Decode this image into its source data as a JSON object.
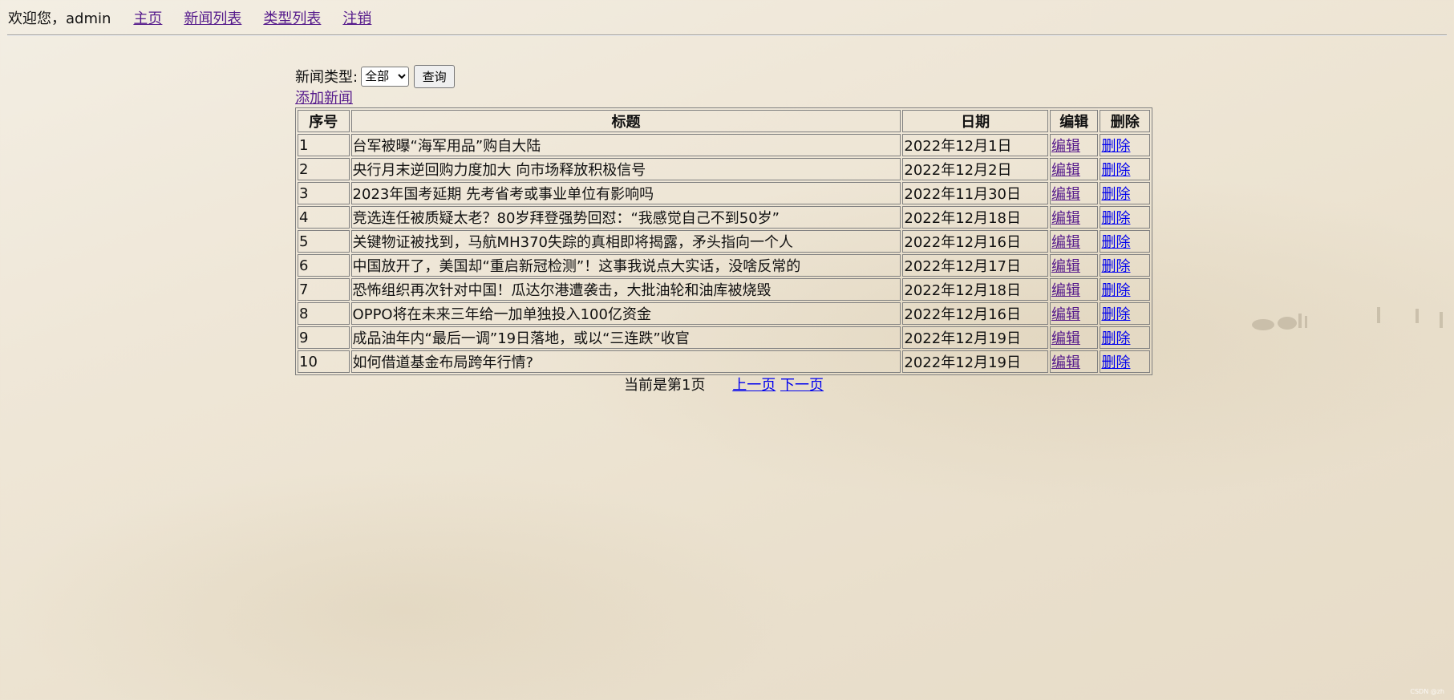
{
  "nav": {
    "welcome": "欢迎您，admin",
    "links": [
      "主页",
      "新闻列表",
      "类型列表",
      "注销"
    ]
  },
  "filter": {
    "label": "新闻类型:",
    "selected": "全部",
    "button": "查询"
  },
  "add_link": "添加新闻",
  "table": {
    "headers": [
      "序号",
      "标题",
      "日期",
      "编辑",
      "删除"
    ],
    "rows": [
      {
        "id": "1",
        "title": "台军被曝“海军用品”购自大陆",
        "date": "2022年12月1日",
        "edit": "编辑",
        "delete": "删除"
      },
      {
        "id": "2",
        "title": "央行月末逆回购力度加大 向市场释放积极信号",
        "date": "2022年12月2日",
        "edit": "编辑",
        "delete": "删除"
      },
      {
        "id": "3",
        "title": "2023年国考延期 先考省考或事业单位有影响吗",
        "date": "2022年11月30日",
        "edit": "编辑",
        "delete": "删除"
      },
      {
        "id": "4",
        "title": "竞选连任被质疑太老？80岁拜登强势回怼：“我感觉自己不到50岁”",
        "date": "2022年12月18日",
        "edit": "编辑",
        "delete": "删除"
      },
      {
        "id": "5",
        "title": "关键物证被找到，马航MH370失踪的真相即将揭露，矛头指向一个人",
        "date": "2022年12月16日",
        "edit": "编辑",
        "delete": "删除"
      },
      {
        "id": "6",
        "title": "中国放开了，美国却“重启新冠检测”！这事我说点大实话，没啥反常的",
        "date": "2022年12月17日",
        "edit": "编辑",
        "delete": "删除"
      },
      {
        "id": "7",
        "title": "恐怖组织再次针对中国！瓜达尔港遭袭击，大批油轮和油库被烧毁",
        "date": "2022年12月18日",
        "edit": "编辑",
        "delete": "删除"
      },
      {
        "id": "8",
        "title": "OPPO将在未来三年给一加单独投入100亿资金",
        "date": "2022年12月16日",
        "edit": "编辑",
        "delete": "删除"
      },
      {
        "id": "9",
        "title": "成品油年内“最后一调”19日落地，或以“三连跌”收官",
        "date": "2022年12月19日",
        "edit": "编辑",
        "delete": "删除"
      },
      {
        "id": "10",
        "title": "如何借道基金布局跨年行情?",
        "date": "2022年12月19日",
        "edit": "编辑",
        "delete": "删除"
      }
    ]
  },
  "pager": {
    "current": "当前是第1页",
    "prev": "上一页",
    "next": "下一页"
  },
  "watermark": "CSDN @zh",
  "colors": {
    "visited_link": "#551a8b",
    "link": "#0000ee",
    "background": "#efe7d8"
  }
}
